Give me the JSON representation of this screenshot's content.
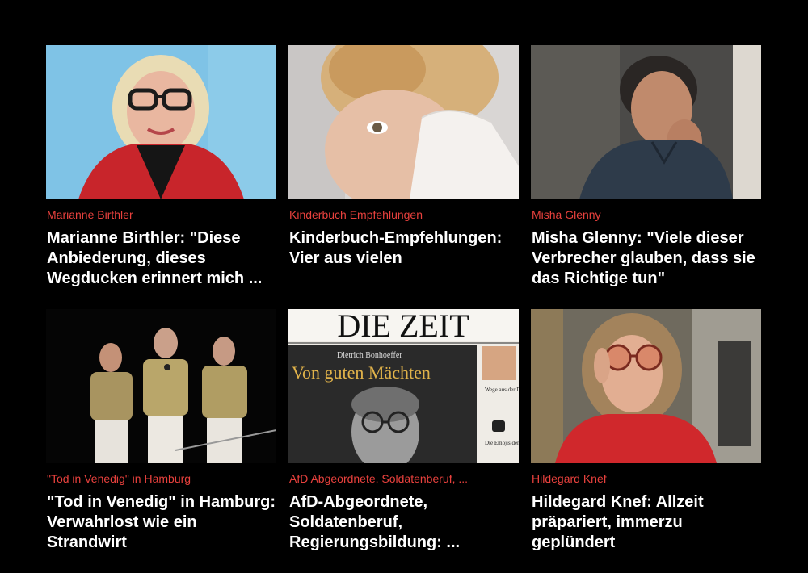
{
  "teasers": [
    {
      "kicker": "Marianne Birthler",
      "headline": "Marianne Birthler: \"Diese Anbiederung, dieses Wegducken erinnert mich ...",
      "image": "portrait-woman-glasses-red-cardigan"
    },
    {
      "kicker": "Kinderbuch Empfehlungen",
      "headline": "Kinderbuch-Empfehlungen: Vier aus vielen",
      "image": "child-reading-book"
    },
    {
      "kicker": "Misha Glenny",
      "headline": "Misha Glenny: \"Viele dieser Verbrecher glauben, dass sie das Richtige tun\"",
      "image": "portrait-man-dark-shirt"
    },
    {
      "kicker": "\"Tod in Venedig\" in Hamburg",
      "headline": "\"Tod in Venedig\" in Hamburg: Verwahrlost wie ein Strandwirt",
      "image": "stage-performers-gold-jackets"
    },
    {
      "kicker": "AfD Abgeordnete, Soldatenberuf, ...",
      "headline": "AfD-Abgeordnete, Soldatenberuf, Regierungsbildung: ...",
      "image": "die-zeit-newspaper-cover",
      "cover": {
        "masthead": "DIE ZEIT",
        "author": "Dietrich Bonhoeffer",
        "cover_title": "Von guten Mächten",
        "sidebar_1": "Wege aus der Depression",
        "sidebar_2": "Die Emojis der Rechten"
      }
    },
    {
      "kicker": "Hildegard Knef",
      "headline": "Hildegard Knef: Allzeit präpariert, immerzu geplündert",
      "image": "woman-sunglasses-red-coat"
    }
  ],
  "colors": {
    "background": "#000000",
    "kicker": "#e8413d",
    "headline": "#ffffff"
  }
}
